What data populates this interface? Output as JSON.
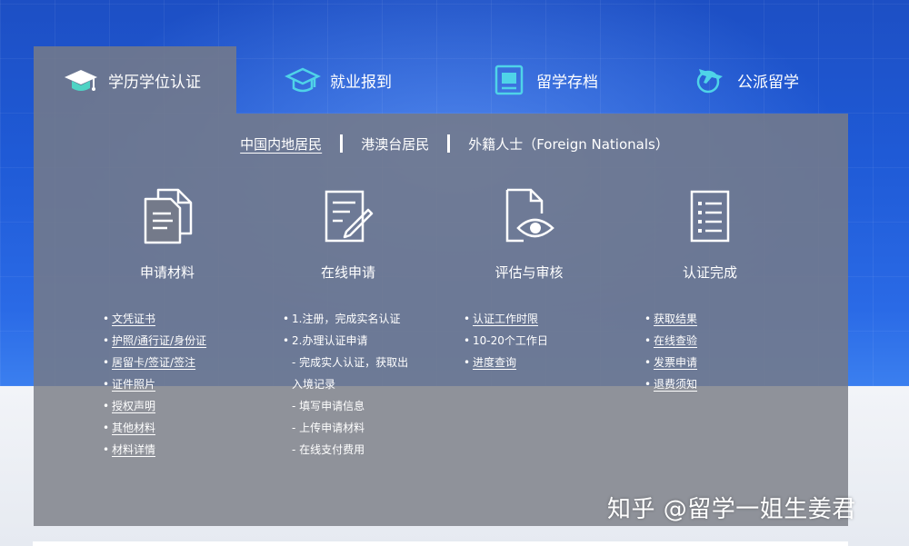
{
  "tabs": [
    {
      "label": "学历学位认证",
      "icon": "graduation-cap-icon",
      "active": true
    },
    {
      "label": "就业报到",
      "icon": "mortarboard-outline-icon",
      "active": false
    },
    {
      "label": "留学存档",
      "icon": "archive-folder-icon",
      "active": false
    },
    {
      "label": "公派留学",
      "icon": "airplane-globe-icon",
      "active": false
    }
  ],
  "subtabs": [
    {
      "label": "中国内地居民",
      "active": true
    },
    {
      "label": "港澳台居民",
      "active": false
    },
    {
      "label": "外籍人士（Foreign Nationals）",
      "active": false
    }
  ],
  "steps": [
    {
      "label": "申请材料",
      "icon": "documents-icon",
      "items": [
        {
          "text": "文凭证书",
          "link": true
        },
        {
          "text": "护照/通行证/身份证",
          "link": true
        },
        {
          "text": "居留卡/签证/签注",
          "link": true
        },
        {
          "text": "证件照片",
          "link": true
        },
        {
          "text": "授权声明",
          "link": true
        },
        {
          "text": "其他材料",
          "link": true
        },
        {
          "text": "材料详情",
          "link": true
        }
      ]
    },
    {
      "label": "在线申请",
      "icon": "form-edit-icon",
      "items": [
        {
          "text": "1.注册，完成实名认证",
          "link": false,
          "bullet": true
        },
        {
          "text": "2.办理认证申请",
          "link": false,
          "bullet": true
        },
        {
          "text": "- 完成实人认证，获取出",
          "link": false,
          "bullet": false
        },
        {
          "text": "入境记录",
          "link": false,
          "bullet": false
        },
        {
          "text": "- 填写申请信息",
          "link": false,
          "bullet": false
        },
        {
          "text": "- 上传申请材料",
          "link": false,
          "bullet": false
        },
        {
          "text": "- 在线支付费用",
          "link": false,
          "bullet": false
        }
      ]
    },
    {
      "label": "评估与审核",
      "icon": "document-eye-icon",
      "items": [
        {
          "text": "认证工作时限",
          "link": true
        },
        {
          "text": "10-20个工作日",
          "link": false
        },
        {
          "text": "进度查询",
          "link": true
        }
      ]
    },
    {
      "label": "认证完成",
      "icon": "checklist-icon",
      "items": [
        {
          "text": "获取结果",
          "link": true
        },
        {
          "text": "在线查验",
          "link": true
        },
        {
          "text": "发票申请",
          "link": true
        },
        {
          "text": "退费须知",
          "link": true
        }
      ]
    }
  ],
  "watermark": "知乎 @留学一姐生姜君"
}
